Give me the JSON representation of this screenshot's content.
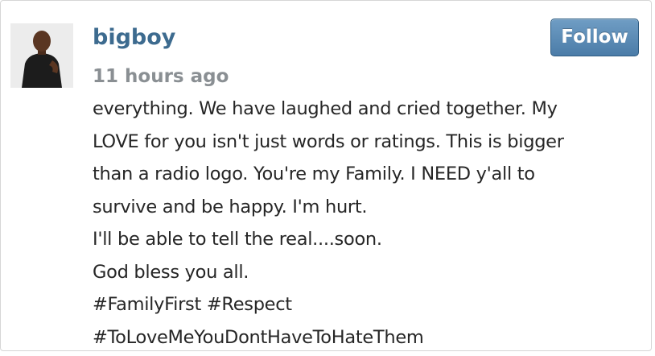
{
  "post": {
    "username": "bigboy",
    "timestamp": "11 hours ago",
    "follow_label": "Follow",
    "avatar_icon": "user-avatar",
    "caption_lines": [
      "everything. We have laughed and cried together. My",
      "LOVE for you isn't just words or ratings. This is bigger",
      "than a radio logo. You're my Family. I NEED y'all to",
      "survive and be happy. I'm hurt.",
      "I'll be able to tell the real....soon.",
      "God bless you all.",
      "#FamilyFirst #Respect",
      "#ToLoveMeYouDontHaveToHateThem"
    ]
  },
  "colors": {
    "username": "#3d6b8f",
    "timestamp": "#8a8f93",
    "follow_button": "#5b8ab5",
    "text": "#262626"
  }
}
